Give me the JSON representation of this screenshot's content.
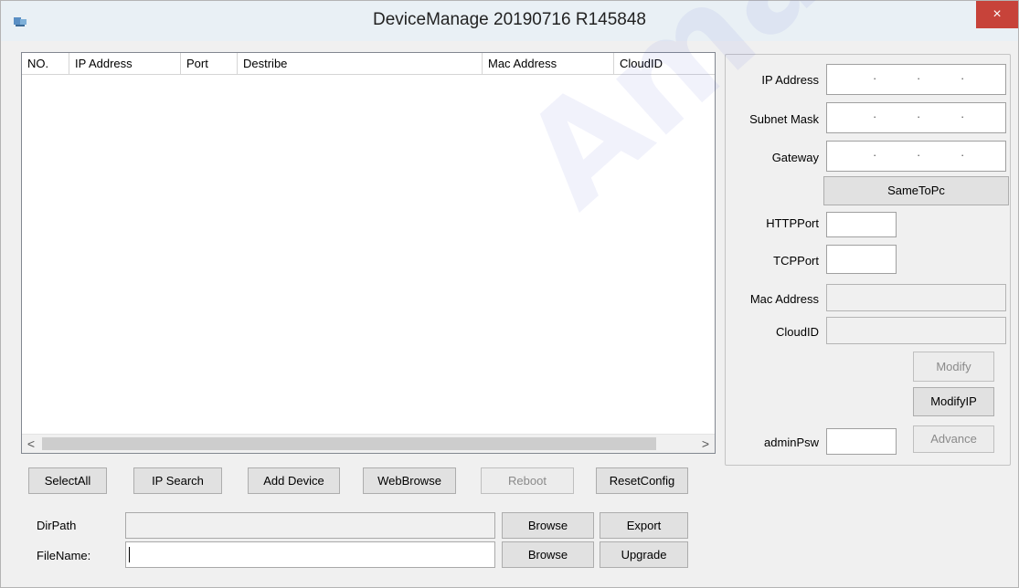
{
  "window": {
    "title": "DeviceManage 20190716 R145848",
    "close_label": "×"
  },
  "list": {
    "columns": [
      "NO.",
      "IP Address",
      "Port",
      "Destribe",
      "Mac Address",
      "CloudID"
    ],
    "scroll_left": "<",
    "scroll_right": ">"
  },
  "panel": {
    "ip_label": "IP Address",
    "subnet_label": "Subnet Mask",
    "gateway_label": "Gateway",
    "ip_dots": [
      "·",
      "·",
      "·"
    ],
    "same_to_pc": "SameToPc",
    "http_label": "HTTPPort",
    "tcp_label": "TCPPort",
    "mac_label": "Mac Address",
    "cloud_label": "CloudID",
    "modify": "Modify",
    "modify_ip": "ModifyIP",
    "admin_label": "adminPsw",
    "advance": "Advance"
  },
  "toolbar": {
    "select_all": "SelectAll",
    "ip_search": "IP Search",
    "add_device": "Add Device",
    "web_browse": "WebBrowse",
    "reboot": "Reboot",
    "reset_config": "ResetConfig"
  },
  "files": {
    "dir_label": "DirPath",
    "file_label": "FileName:",
    "browse1": "Browse",
    "browse2": "Browse",
    "export": "Export",
    "upgrade": "Upgrade"
  },
  "watermark": "Amatek"
}
